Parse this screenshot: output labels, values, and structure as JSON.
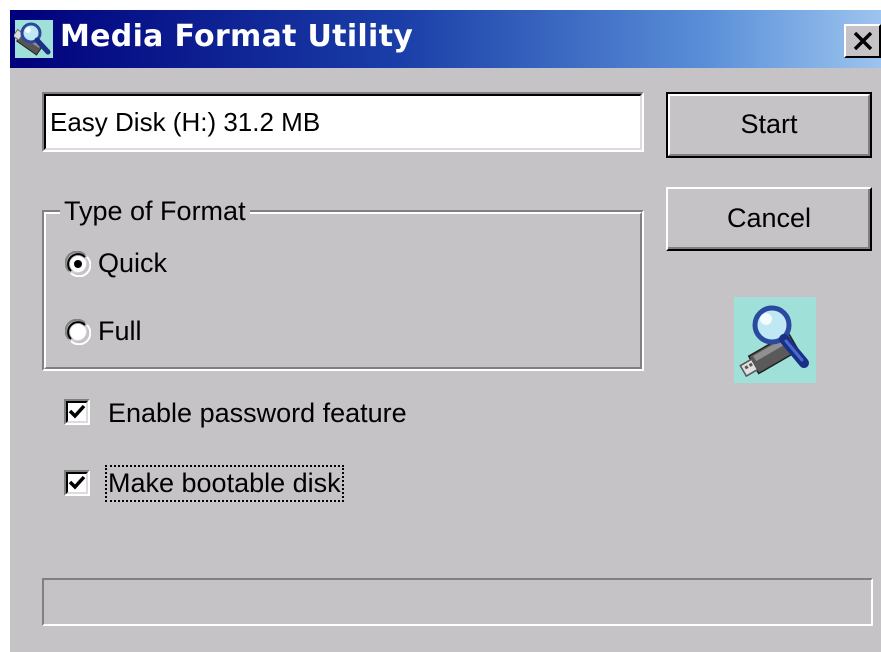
{
  "window": {
    "title": "Media Format Utility",
    "title_icon": "usb-drive-magnifier-icon",
    "close_icon": "close-icon"
  },
  "drive": {
    "value": "Easy Disk (H:)  31.2 MB"
  },
  "buttons": {
    "start_label": "Start",
    "cancel_label": "Cancel"
  },
  "format_type": {
    "legend": "Type of Format",
    "options": [
      {
        "label": "Quick",
        "selected": true
      },
      {
        "label": "Full",
        "selected": false
      }
    ]
  },
  "options": {
    "password": {
      "label": "Enable password feature",
      "checked": true
    },
    "bootable": {
      "label": "Make bootable disk",
      "checked": true
    }
  },
  "progress": {
    "value": 0
  },
  "colors": {
    "face": "#c6c3c6",
    "title_start": "#00007b",
    "title_end": "#9cc4ee"
  },
  "app_icon": "usb-drive-magnifier-icon"
}
